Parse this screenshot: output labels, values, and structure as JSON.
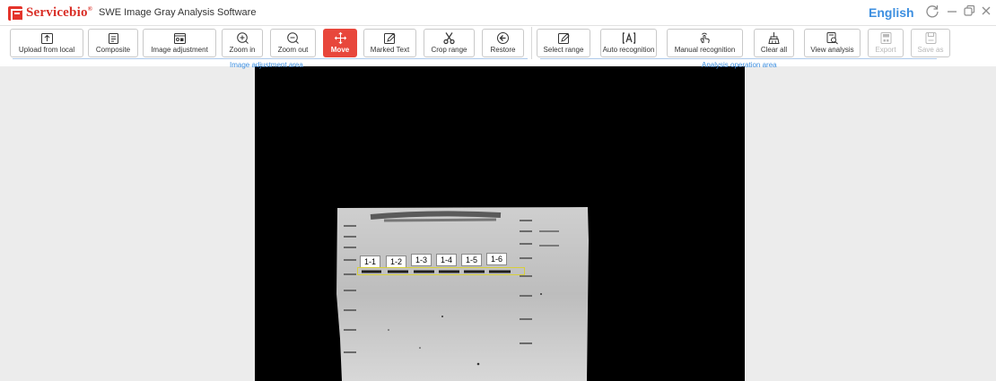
{
  "titlebar": {
    "brand": "Servicebio",
    "brand_reg": "®",
    "app_title": "SWE Image Gray Analysis Software",
    "language": "English"
  },
  "toolbar": {
    "upload": "Upload from local",
    "composite": "Composite",
    "image_adjustment": "Image adjustment",
    "zoom_in": "Zoom in",
    "zoom_out": "Zoom out",
    "move": "Move",
    "marked_text": "Marked Text",
    "crop_range": "Crop range",
    "restore": "Restore",
    "select_range": "Select range",
    "auto_recognition": "Auto recognition",
    "manual_recognition": "Manual recognition",
    "clear_all": "Clear all",
    "view_analysis": "View analysis",
    "export": "Export",
    "save_as": "Save as"
  },
  "groups": {
    "image_adjustment_area": "Image adjustment area",
    "analysis_operation_area": "Analysis operation area"
  },
  "lanes": [
    "1-1",
    "1-2",
    "1-3",
    "1-4",
    "1-5",
    "1-6"
  ],
  "colors": {
    "brand_red": "#d92f27",
    "active_button": "#e8473c",
    "accent_blue": "#3d8fe0",
    "selection_yellow": "#d7cf3a"
  }
}
